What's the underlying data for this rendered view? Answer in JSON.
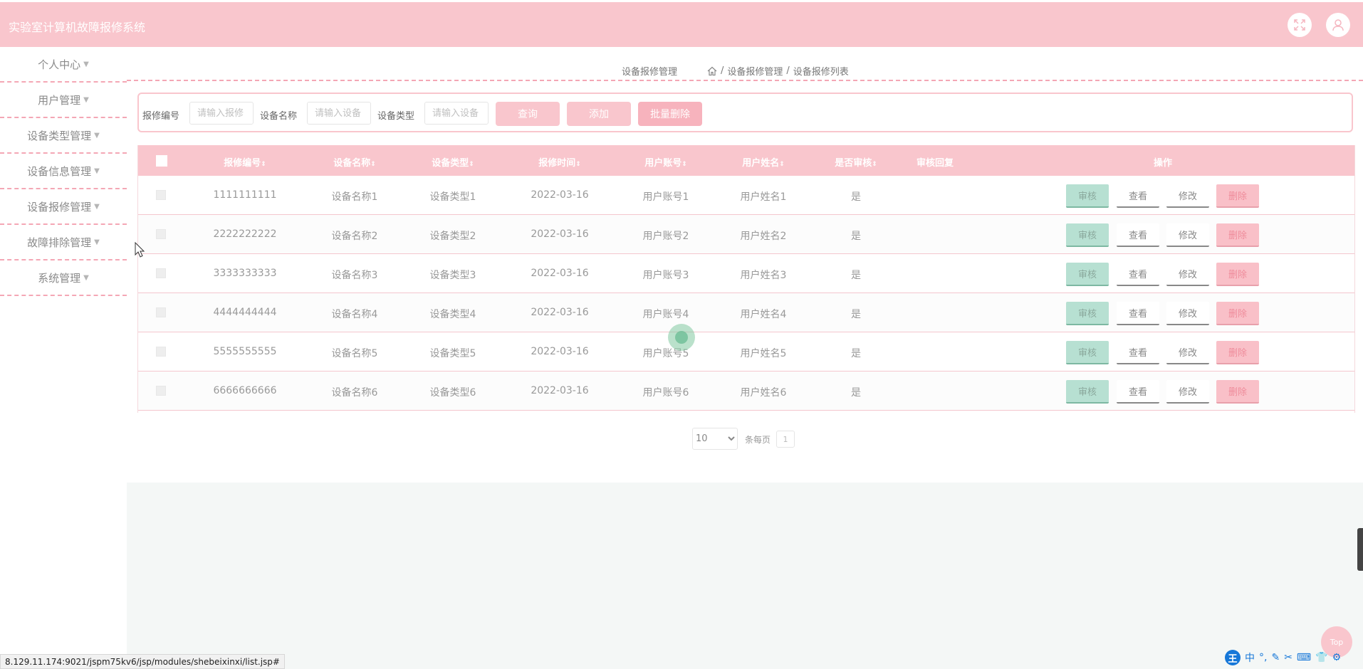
{
  "header": {
    "title": "实验室计算机故障报修系统"
  },
  "sidebar": {
    "items": [
      {
        "label": "个人中心"
      },
      {
        "label": "用户管理"
      },
      {
        "label": "设备类型管理"
      },
      {
        "label": "设备信息管理"
      },
      {
        "label": "设备报修管理"
      },
      {
        "label": "故障排除管理"
      },
      {
        "label": "系统管理"
      }
    ]
  },
  "breadcrumb": {
    "title": "设备报修管理",
    "separator": "/",
    "level1": "设备报修管理",
    "level2": "设备报修列表"
  },
  "search": {
    "label1": "报修编号",
    "placeholder1": "请输入报修",
    "label2": "设备名称",
    "placeholder2": "请输入设备",
    "label3": "设备类型",
    "placeholder3": "请输入设备",
    "query_button": "查询",
    "add_button": "添加",
    "batch_delete_button": "批量删除"
  },
  "table": {
    "columns": [
      "报修编号",
      "设备名称",
      "设备类型",
      "报修时间",
      "用户账号",
      "用户姓名",
      "是否审核",
      "审核回复",
      "操作"
    ],
    "sort_glyph": "⇕",
    "rows": [
      {
        "id": "1111111111",
        "name": "设备名称1",
        "type": "设备类型1",
        "time": "2022-03-16",
        "account": "用户账号1",
        "username": "用户姓名1",
        "reviewed": "是",
        "reply": ""
      },
      {
        "id": "2222222222",
        "name": "设备名称2",
        "type": "设备类型2",
        "time": "2022-03-16",
        "account": "用户账号2",
        "username": "用户姓名2",
        "reviewed": "是",
        "reply": ""
      },
      {
        "id": "3333333333",
        "name": "设备名称3",
        "type": "设备类型3",
        "time": "2022-03-16",
        "account": "用户账号3",
        "username": "用户姓名3",
        "reviewed": "是",
        "reply": ""
      },
      {
        "id": "4444444444",
        "name": "设备名称4",
        "type": "设备类型4",
        "time": "2022-03-16",
        "account": "用户账号4",
        "username": "用户姓名4",
        "reviewed": "是",
        "reply": ""
      },
      {
        "id": "5555555555",
        "name": "设备名称5",
        "type": "设备类型5",
        "time": "2022-03-16",
        "account": "用户账号5",
        "username": "用户姓名5",
        "reviewed": "是",
        "reply": ""
      },
      {
        "id": "6666666666",
        "name": "设备名称6",
        "type": "设备类型6",
        "time": "2022-03-16",
        "account": "用户账号6",
        "username": "用户姓名6",
        "reviewed": "是",
        "reply": ""
      }
    ],
    "actions": {
      "review": "审核",
      "view": "查看",
      "edit": "修改",
      "delete": "删除"
    }
  },
  "pagination": {
    "page_size": "10",
    "per_page_label": "条每页",
    "current_page": "1"
  },
  "back_to_top": "Top",
  "status_url": "8.129.11.174:9021/jspm75kv6/jsp/modules/shebeixinxi/list.jsp#",
  "ime": {
    "logo": "王",
    "mode": "中",
    "punct": "°,"
  },
  "colors": {
    "primary": "#f9c6cd",
    "review": "#b7e0d2",
    "delete": "#f9c0c8"
  }
}
